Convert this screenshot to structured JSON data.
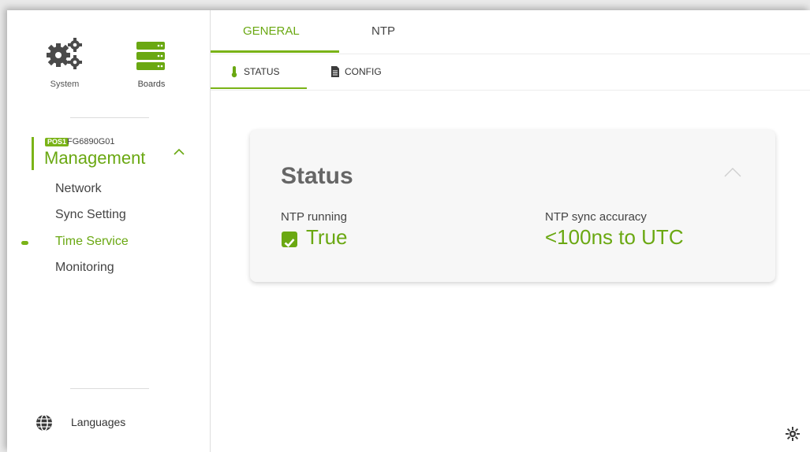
{
  "sidebar": {
    "system_label": "System",
    "boards_label": "Boards",
    "device": {
      "position_tag": "POS1",
      "id": "FG6890G01",
      "section_title": "Management"
    },
    "items": [
      {
        "label": "Network"
      },
      {
        "label": "Sync Setting"
      },
      {
        "label": "Time Service"
      },
      {
        "label": "Monitoring"
      }
    ],
    "languages_label": "Languages"
  },
  "tabs": {
    "primary": [
      {
        "label": "GENERAL"
      },
      {
        "label": "NTP"
      }
    ],
    "secondary": [
      {
        "label": "STATUS"
      },
      {
        "label": "CONFIG"
      }
    ]
  },
  "status_card": {
    "title": "Status",
    "ntp_running_label": "NTP running",
    "ntp_running_value": "True",
    "accuracy_label": "NTP sync accuracy",
    "accuracy_value": "<100ns to UTC"
  },
  "colors": {
    "accent": "#6aa812",
    "accent_light": "#7ab317"
  },
  "icons": {
    "system": "gears-icon",
    "boards": "server-icon",
    "collapse": "chevron-up-icon",
    "status_tab": "thermometer-icon",
    "config_tab": "document-icon",
    "check": "checkbox-checked-icon",
    "languages": "globe-icon",
    "settings": "settings-sun-icon"
  }
}
